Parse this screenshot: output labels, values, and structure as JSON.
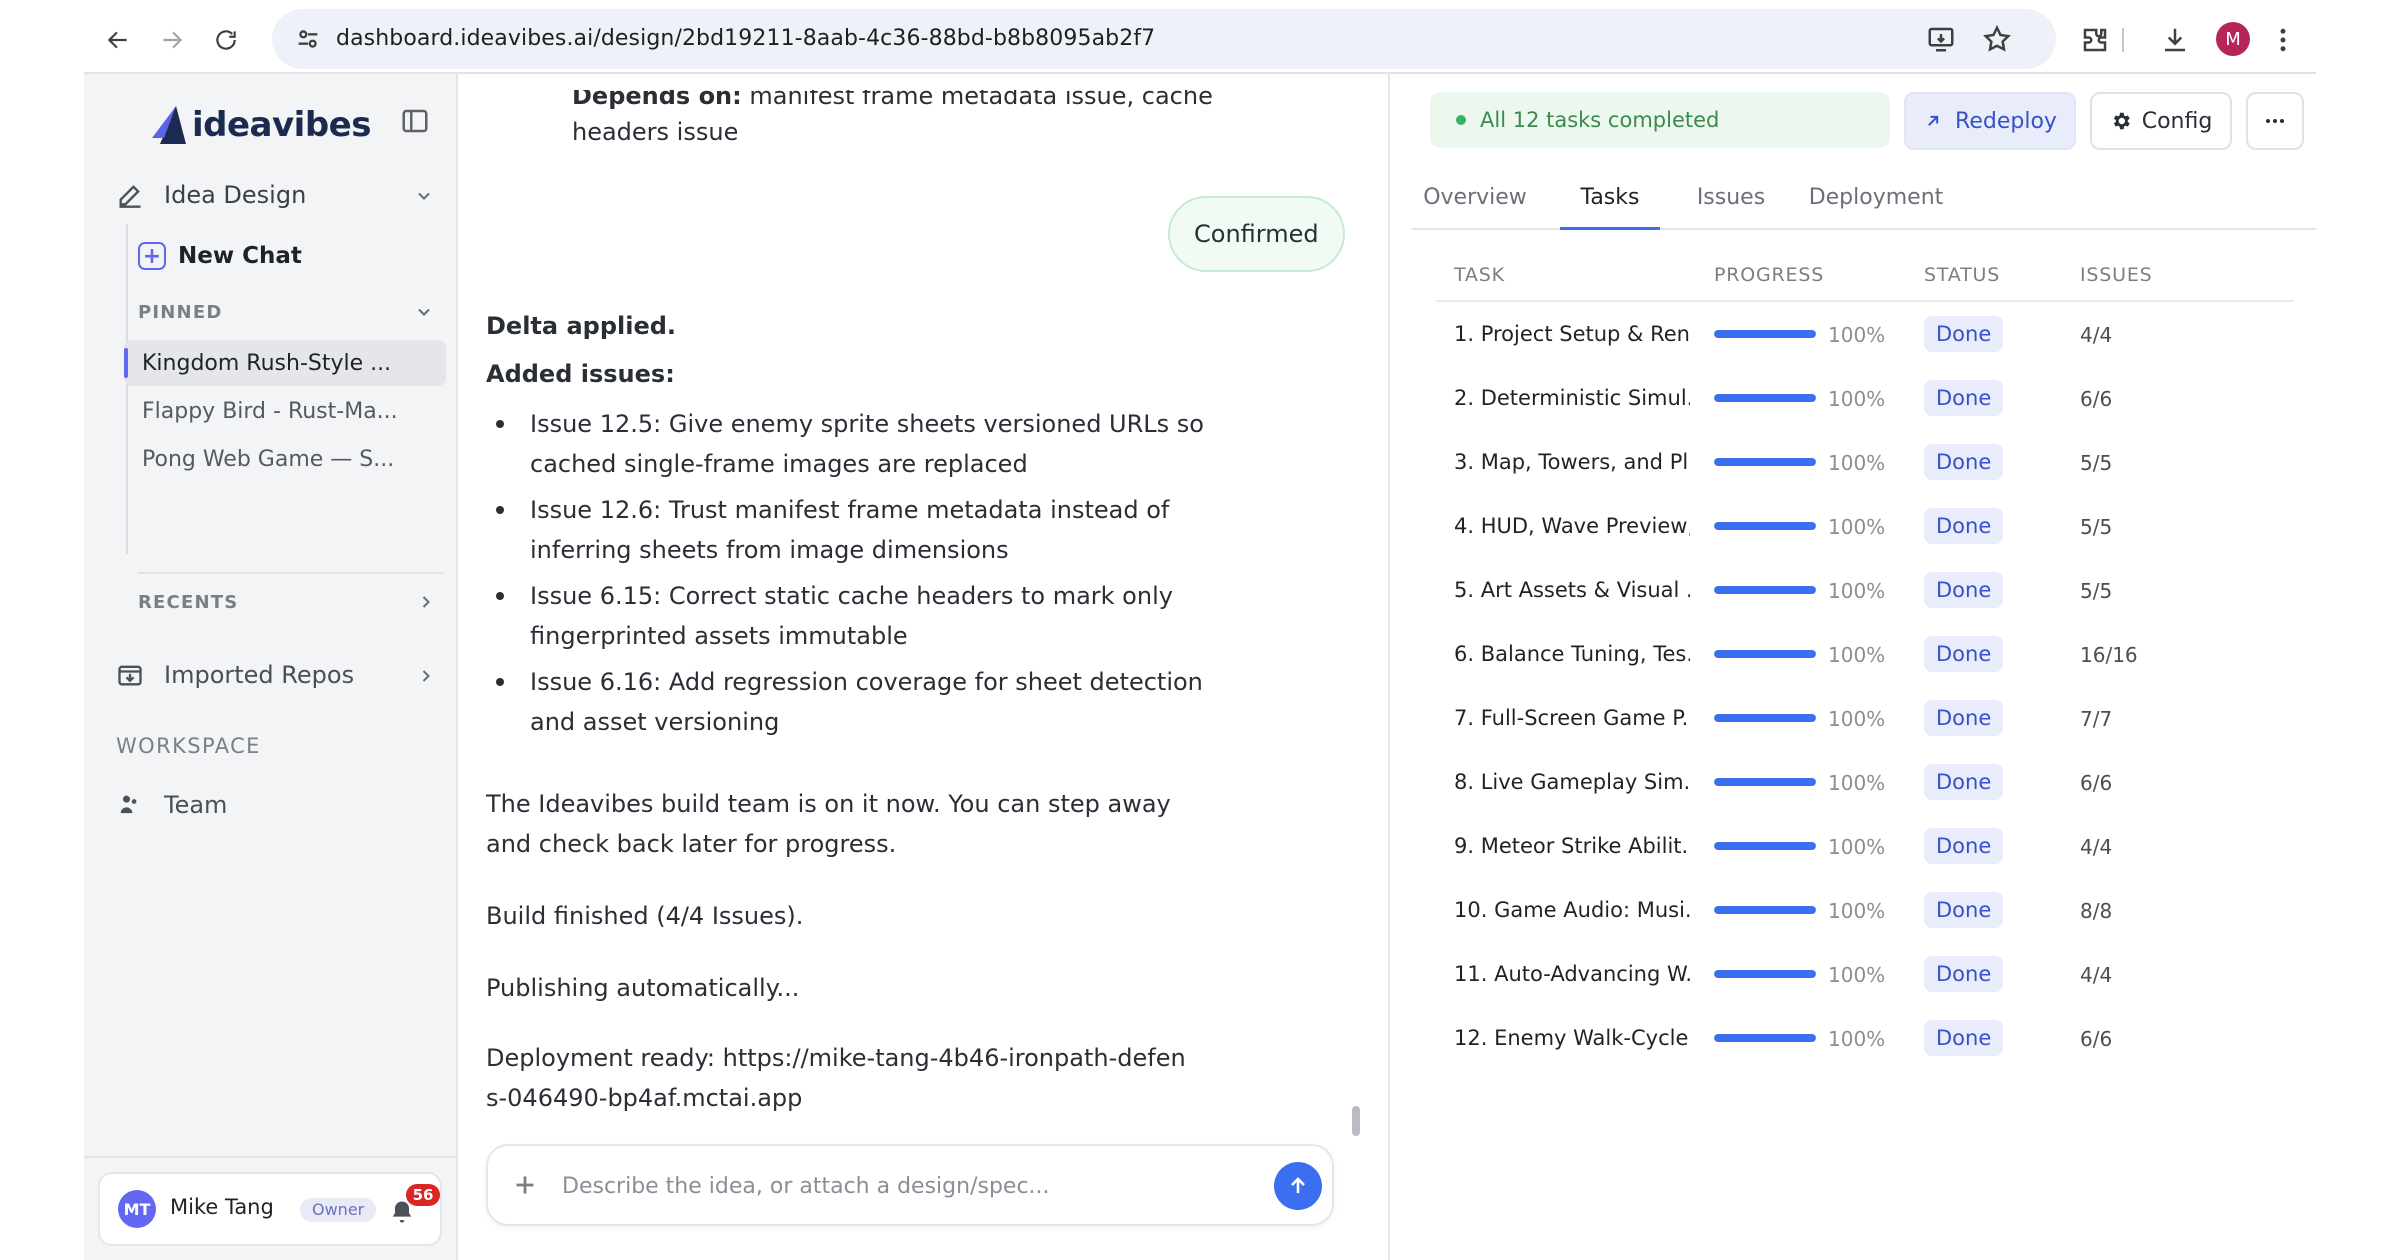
{
  "browser": {
    "url": "dashboard.ideavibes.ai/design/2bd19211-8aab-4c36-88bd-b8b8095ab2f7",
    "profile_initial": "M"
  },
  "sidebar": {
    "brand": "ideavibes",
    "section_title": "Idea Design",
    "new_chat": "New Chat",
    "pinned_label": "PINNED",
    "pinned": [
      {
        "label": "Kingdom Rush-Style ...",
        "active": true
      },
      {
        "label": "Flappy Bird - Rust-Ma...",
        "active": false
      },
      {
        "label": "Pong Web Game — S...",
        "active": false
      }
    ],
    "recents_label": "RECENTS",
    "imported_repos": "Imported Repos",
    "workspace_label": "WORKSPACE",
    "team": "Team",
    "user": {
      "initials": "MT",
      "name": "Mike Tang",
      "role": "Owner",
      "notification_count": "56"
    }
  },
  "chat": {
    "partial_prefix": "Depends on:",
    "partial_rest": "manifest frame metadata issue, cache",
    "partial_line2": "headers issue",
    "confirmed": "Confirmed",
    "delta_applied": "Delta applied.",
    "added_issues": "Added issues:",
    "issues": [
      "Issue 12.5: Give enemy sprite sheets versioned URLs so cached single-frame images are replaced",
      "Issue 12.6: Trust manifest frame metadata instead of inferring sheets from image dimensions",
      "Issue 6.15: Correct static cache headers to mark only fingerprinted assets immutable",
      "Issue 6.16: Add regression coverage for sheet detection and asset versioning"
    ],
    "build_team": "The Ideavibes build team is on it now. You can step away and check back later for progress.",
    "build_finished": "Build finished (4/4 Issues).",
    "publishing": "Publishing automatically...",
    "deployment_ready": "Deployment ready: https://mike-tang-4b46-ironpath-defens-046490-bp4af.mctai.app",
    "composer_placeholder": "Describe the idea, or attach a design/spec..."
  },
  "panel": {
    "status": "All 12 tasks completed",
    "redeploy": "Redeploy",
    "config": "Config",
    "tabs": [
      "Overview",
      "Tasks",
      "Issues",
      "Deployment"
    ],
    "active_tab": "Tasks",
    "columns": [
      "TASK",
      "PROGRESS",
      "STATUS",
      "ISSUES"
    ],
    "tasks": [
      {
        "name": "1. Project Setup & Ren...",
        "progress": 100,
        "progress_label": "100%",
        "status": "Done",
        "issues": "4/4"
      },
      {
        "name": "2. Deterministic Simul...",
        "progress": 100,
        "progress_label": "100%",
        "status": "Done",
        "issues": "6/6"
      },
      {
        "name": "3. Map, Towers, and Pl...",
        "progress": 100,
        "progress_label": "100%",
        "status": "Done",
        "issues": "5/5"
      },
      {
        "name": "4. HUD, Wave Preview,...",
        "progress": 100,
        "progress_label": "100%",
        "status": "Done",
        "issues": "5/5"
      },
      {
        "name": "5. Art Assets & Visual ...",
        "progress": 100,
        "progress_label": "100%",
        "status": "Done",
        "issues": "5/5"
      },
      {
        "name": "6. Balance Tuning, Tes...",
        "progress": 100,
        "progress_label": "100%",
        "status": "Done",
        "issues": "16/16"
      },
      {
        "name": "7. Full-Screen Game P...",
        "progress": 100,
        "progress_label": "100%",
        "status": "Done",
        "issues": "7/7"
      },
      {
        "name": "8. Live Gameplay Sim...",
        "progress": 100,
        "progress_label": "100%",
        "status": "Done",
        "issues": "6/6"
      },
      {
        "name": "9. Meteor Strike Abilit...",
        "progress": 100,
        "progress_label": "100%",
        "status": "Done",
        "issues": "4/4"
      },
      {
        "name": "10. Game Audio: Musi...",
        "progress": 100,
        "progress_label": "100%",
        "status": "Done",
        "issues": "8/8"
      },
      {
        "name": "11. Auto-Advancing W...",
        "progress": 100,
        "progress_label": "100%",
        "status": "Done",
        "issues": "4/4"
      },
      {
        "name": "12. Enemy Walk-Cycle ...",
        "progress": 100,
        "progress_label": "100%",
        "status": "Done",
        "issues": "6/6"
      }
    ]
  },
  "colors": {
    "accent": "#3b6ff0",
    "brand": "#6366f1",
    "success": "#3ab26a",
    "danger": "#dc2626"
  },
  "icons": [
    "back-icon",
    "forward-icon",
    "reload-icon",
    "site-info-icon",
    "install-icon",
    "star-icon",
    "extensions-icon",
    "download-icon",
    "kebab-icon",
    "sidebar-toggle-icon",
    "pencil-icon",
    "plus-icon",
    "repo-icon",
    "team-icon",
    "bell-icon",
    "arrow-up-icon",
    "external-arrow-icon",
    "gear-icon",
    "more-icon"
  ]
}
